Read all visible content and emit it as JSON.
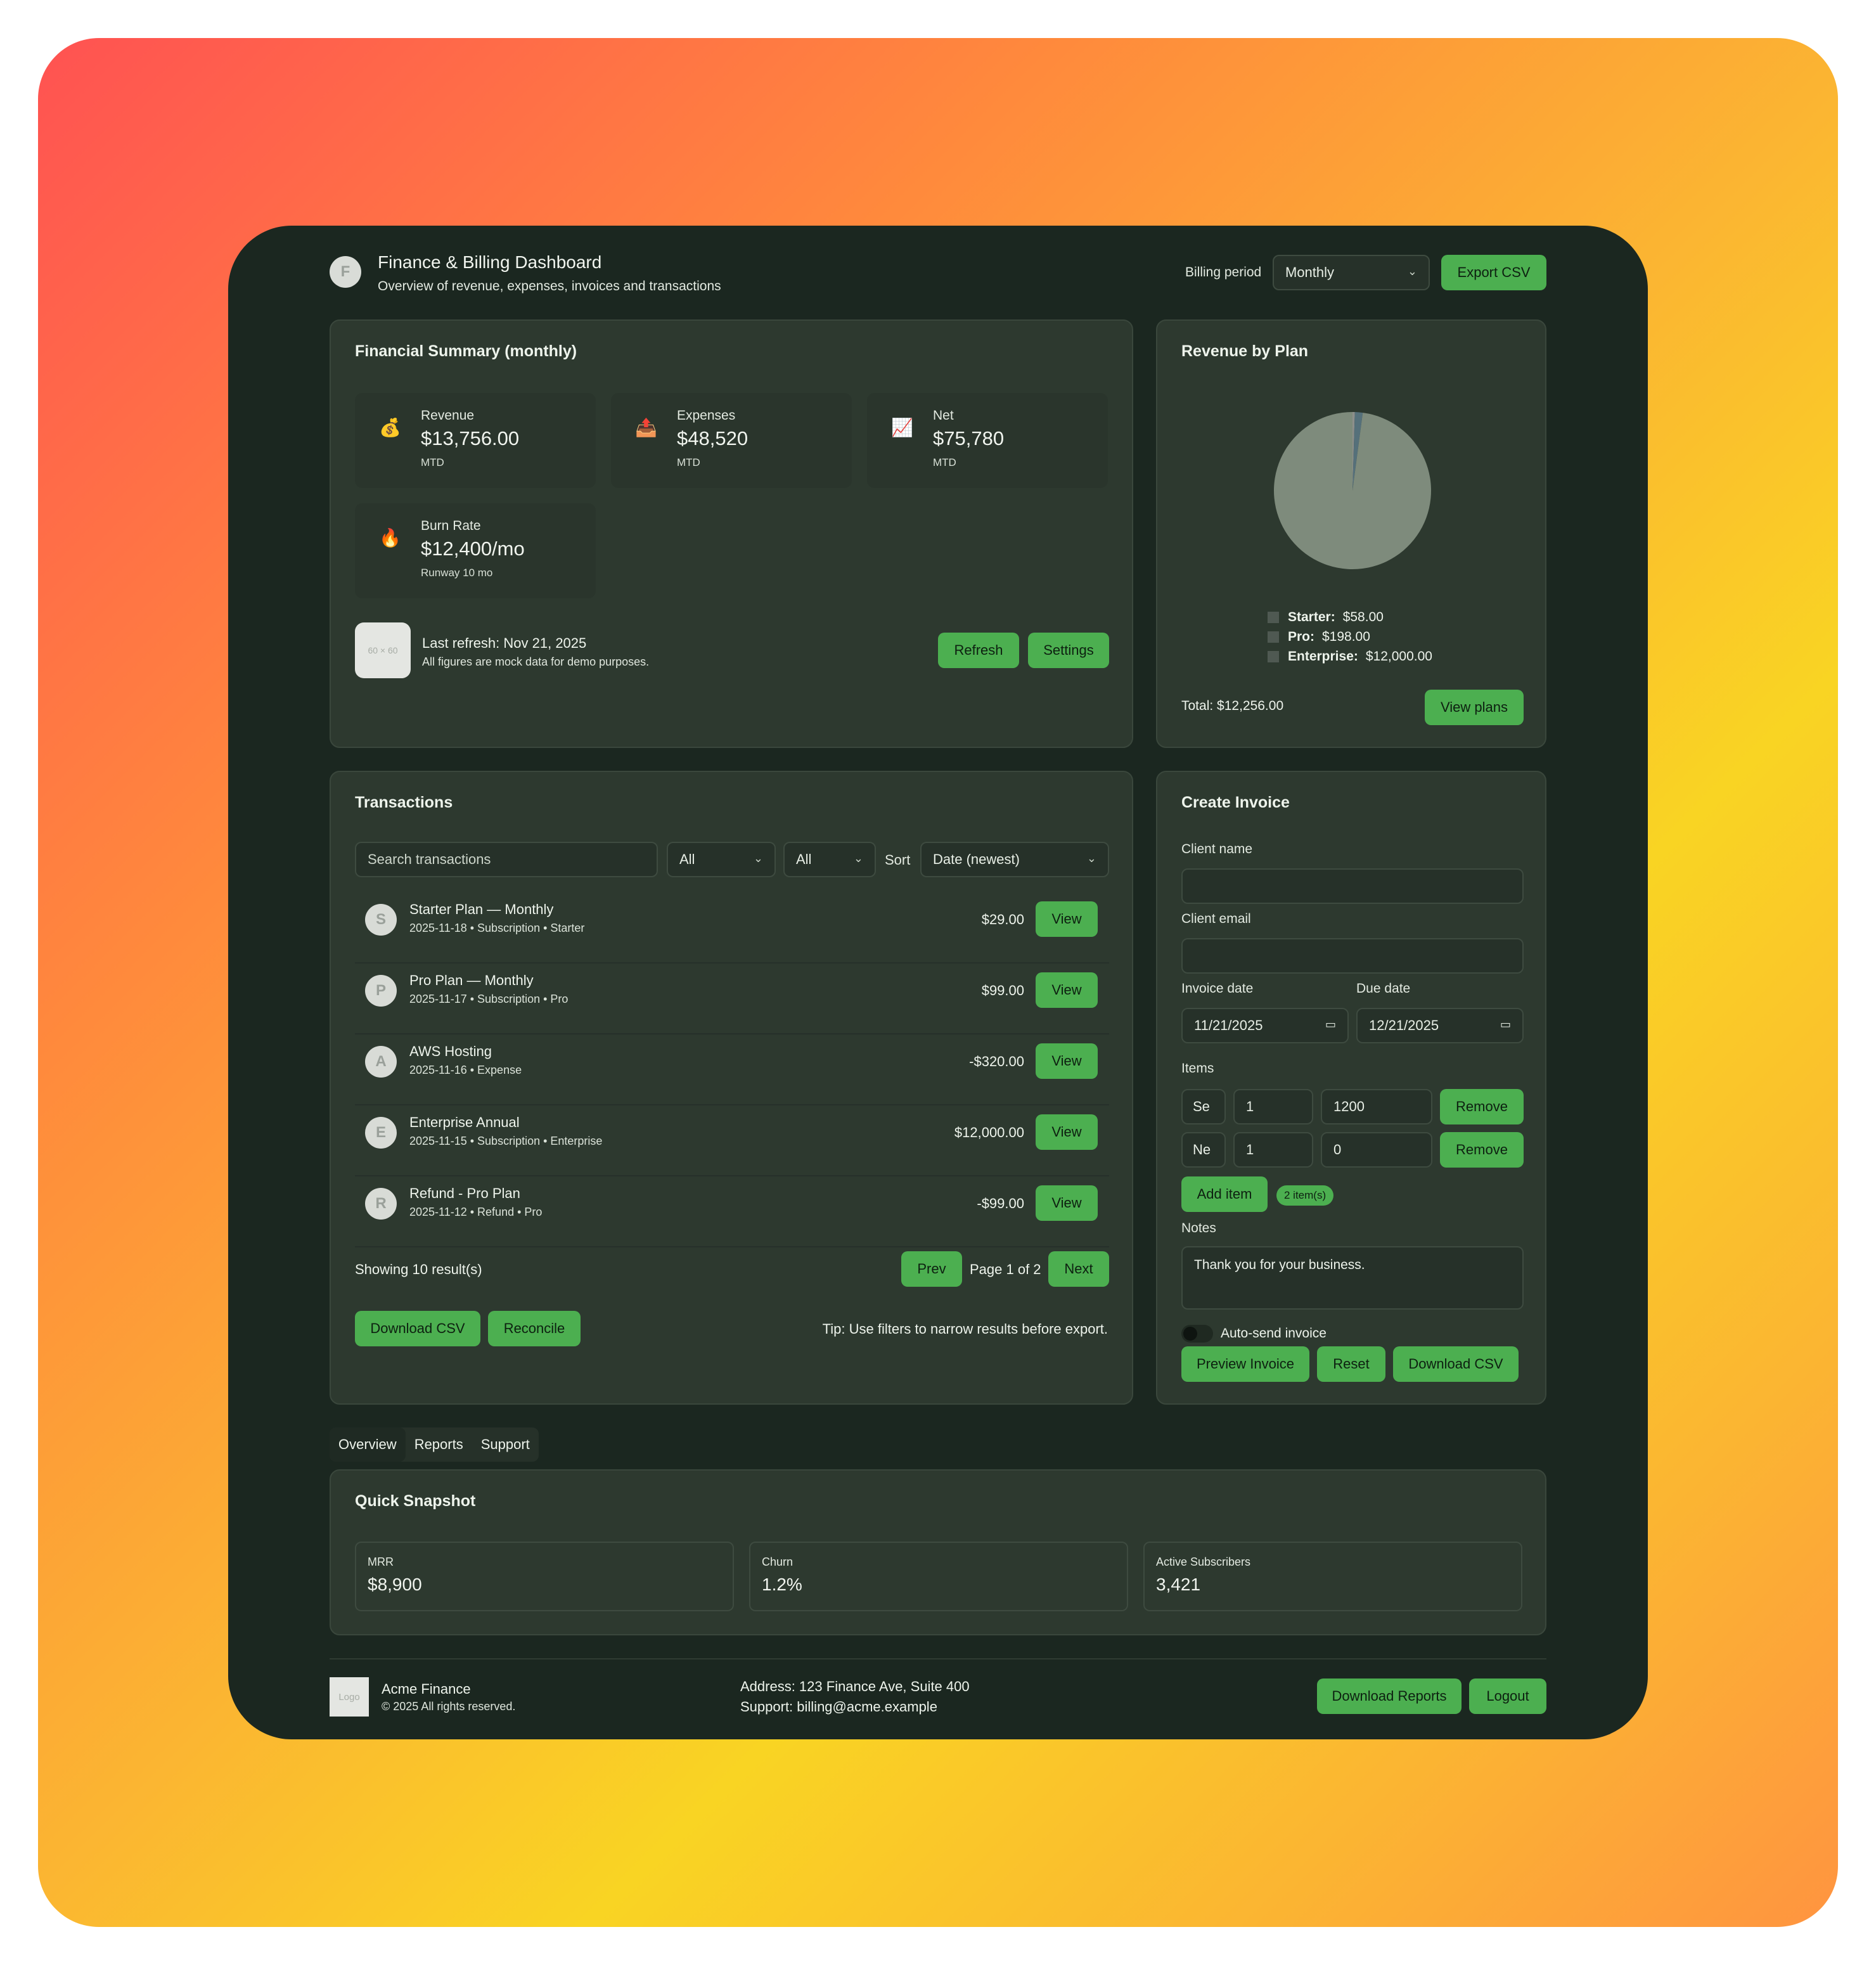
{
  "header": {
    "avatar_letter": "F",
    "title": "Finance & Billing Dashboard",
    "subtitle": "Overview of revenue, expenses, invoices and transactions",
    "billing_period_label": "Billing period",
    "billing_period_value": "Monthly",
    "export_label": "Export CSV"
  },
  "summary": {
    "title": "Financial Summary (monthly)",
    "metrics": [
      {
        "icon": "💰",
        "label": "Revenue",
        "value": "$13,756.00",
        "sub": "MTD"
      },
      {
        "icon": "📤",
        "label": "Expenses",
        "value": "$48,520",
        "sub": "MTD"
      },
      {
        "icon": "📈",
        "label": "Net",
        "value": "$75,780",
        "sub": "MTD"
      },
      {
        "icon": "🔥",
        "label": "Burn Rate",
        "value": "$12,400/mo",
        "sub": "Runway 10 mo"
      }
    ],
    "placeholder": "60 × 60",
    "last_refresh": "Last refresh: Nov 21, 2025",
    "note": "All figures are mock data for demo purposes.",
    "refresh_label": "Refresh",
    "settings_label": "Settings"
  },
  "revenue_plan": {
    "title": "Revenue by Plan",
    "legend": [
      {
        "name": "Starter:",
        "value": "$58.00"
      },
      {
        "name": "Pro:",
        "value": "$198.00"
      },
      {
        "name": "Enterprise:",
        "value": "$12,000.00"
      }
    ],
    "total": "Total: $12,256.00",
    "view_plans_label": "View plans"
  },
  "chart_data": {
    "type": "pie",
    "categories": [
      "Starter",
      "Pro",
      "Enterprise"
    ],
    "values": [
      58,
      198,
      12000
    ],
    "colors": [
      "#8d8f8b",
      "#55707a",
      "#7e8b7c"
    ]
  },
  "transactions": {
    "title": "Transactions",
    "search_placeholder": "Search transactions",
    "filter1": "All",
    "filter2": "All",
    "sort_label": "Sort",
    "sort_value": "Date (newest)",
    "rows": [
      {
        "letter": "S",
        "name": "Starter Plan — Monthly",
        "meta": "2025-11-18 • Subscription • Starter",
        "amount": "$29.00",
        "action": "View"
      },
      {
        "letter": "P",
        "name": "Pro Plan — Monthly",
        "meta": "2025-11-17 • Subscription • Pro",
        "amount": "$99.00",
        "action": "View"
      },
      {
        "letter": "A",
        "name": "AWS Hosting",
        "meta": "2025-11-16 • Expense",
        "amount": "-$320.00",
        "action": "View"
      },
      {
        "letter": "E",
        "name": "Enterprise Annual",
        "meta": "2025-11-15 • Subscription • Enterprise",
        "amount": "$12,000.00",
        "action": "View"
      },
      {
        "letter": "R",
        "name": "Refund - Pro Plan",
        "meta": "2025-11-12 • Refund • Pro",
        "amount": "-$99.00",
        "action": "View"
      }
    ],
    "showing": "Showing 10 result(s)",
    "prev_label": "Prev",
    "page_info": "Page 1 of 2",
    "next_label": "Next",
    "download_label": "Download CSV",
    "reconcile_label": "Reconcile",
    "tip": "Tip: Use filters to narrow results before export."
  },
  "invoice": {
    "title": "Create Invoice",
    "client_name_label": "Client name",
    "client_email_label": "Client email",
    "invoice_date_label": "Invoice date",
    "invoice_date_value": "11/21/2025",
    "due_date_label": "Due date",
    "due_date_value": "12/21/2025",
    "items_label": "Items",
    "items": [
      {
        "desc": "Se",
        "qty": "1",
        "price": "1200",
        "remove_label": "Remove"
      },
      {
        "desc": "Ne",
        "qty": "1",
        "price": "0",
        "remove_label": "Remove"
      }
    ],
    "add_item_label": "Add item",
    "item_count": "2 item(s)",
    "notes_label": "Notes",
    "notes_value": "Thank you for your business.",
    "auto_send_label": "Auto-send invoice",
    "preview_label": "Preview Invoice",
    "reset_label": "Reset",
    "download_label": "Download CSV"
  },
  "tabs": [
    "Overview",
    "Reports",
    "Support"
  ],
  "snapshot": {
    "title": "Quick Snapshot",
    "cards": [
      {
        "label": "MRR",
        "value": "$8,900"
      },
      {
        "label": "Churn",
        "value": "1.2%"
      },
      {
        "label": "Active Subscribers",
        "value": "3,421"
      }
    ]
  },
  "footer": {
    "logo_text": "Logo",
    "company": "Acme Finance",
    "copyright": "© 2025 All rights reserved.",
    "address": "Address: 123 Finance Ave, Suite 400",
    "support": "Support: billing@acme.example",
    "download_reports_label": "Download Reports",
    "logout_label": "Logout"
  }
}
